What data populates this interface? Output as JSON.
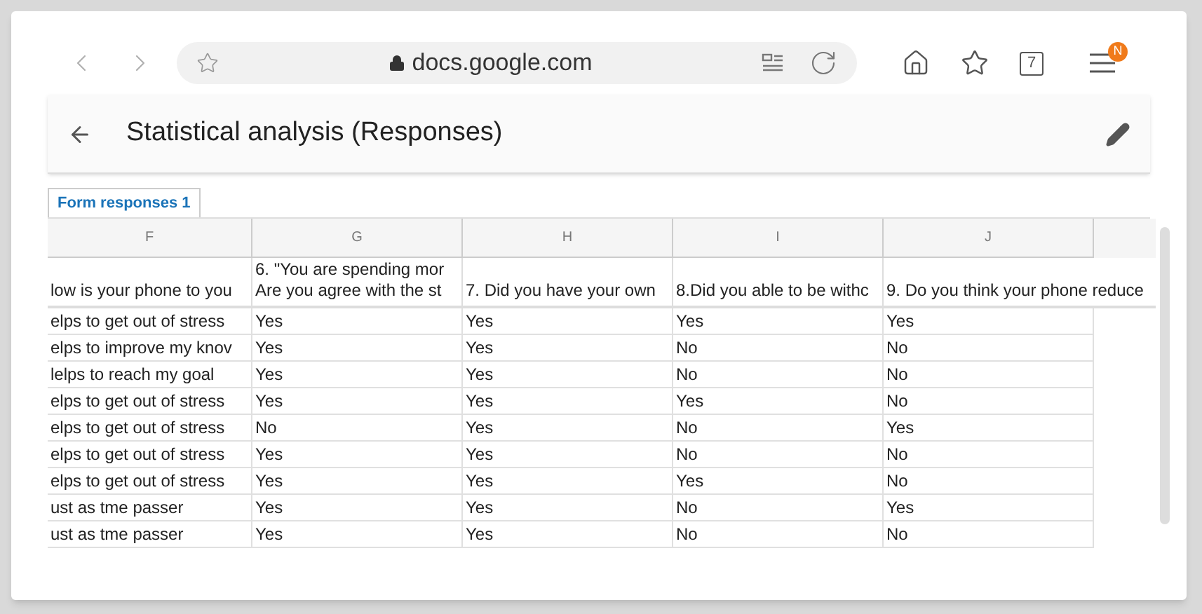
{
  "browser": {
    "url": "docs.google.com",
    "tab_count": "7",
    "menu_badge": "N"
  },
  "header": {
    "title": "Statistical analysis (Responses)"
  },
  "sheet_tabs": [
    {
      "label": "Form responses 1",
      "selected": true
    }
  ],
  "columns": [
    "F",
    "G",
    "H",
    "I",
    "J"
  ],
  "question_row": [
    [
      "low is your phone to you"
    ],
    [
      "6. \"You are spending mor",
      "Are you agree with the st"
    ],
    [
      "7. Did you have your own"
    ],
    [
      "8.Did you able to be withc"
    ],
    [
      "9. Do you think your phone reduce"
    ]
  ],
  "rows": [
    [
      "elps to get out of stress",
      "Yes",
      "Yes",
      "Yes",
      "Yes"
    ],
    [
      "elps to improve my knov",
      "Yes",
      "Yes",
      "No",
      "No"
    ],
    [
      "lelps to reach my goal",
      "Yes",
      "Yes",
      "No",
      "No"
    ],
    [
      "elps to get out of stress",
      "Yes",
      "Yes",
      "Yes",
      "No"
    ],
    [
      "elps to get out of stress",
      "No",
      "Yes",
      "No",
      "Yes"
    ],
    [
      "elps to get out of stress",
      "Yes",
      "Yes",
      "No",
      "No"
    ],
    [
      "elps to get out of stress",
      "Yes",
      "Yes",
      "Yes",
      "No"
    ],
    [
      "ust as tme passer",
      "Yes",
      "Yes",
      "No",
      "Yes"
    ],
    [
      "ust as tme passer",
      "Yes",
      "Yes",
      "No",
      "No"
    ]
  ]
}
